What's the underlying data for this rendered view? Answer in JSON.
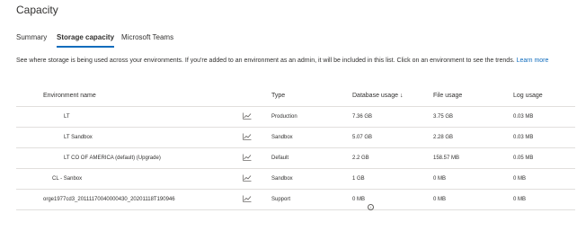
{
  "page": {
    "title": "Capacity"
  },
  "tabs": [
    {
      "label": "Summary"
    },
    {
      "label": "Storage capacity"
    },
    {
      "label": "Microsoft Teams"
    }
  ],
  "description": {
    "text": "See where storage is being used across your environments. If you're added to an environment as an admin, it will be included in this list. Click on an environment to see the trends.",
    "link": "Learn more"
  },
  "table": {
    "headers": {
      "environment": "Environment name",
      "type": "Type",
      "database": "Database usage",
      "file": "File usage",
      "log": "Log usage"
    },
    "rows": [
      {
        "name": "LT",
        "type": "Production",
        "database": "7.36 GB",
        "file": "3.75 GB",
        "log": "0.03 MB"
      },
      {
        "name": "LT Sandbox",
        "type": "Sandbox",
        "database": "5.07 GB",
        "file": "2.28 GB",
        "log": "0.03 MB"
      },
      {
        "name": "LT CO OF AMERICA (default) (Upgrade)",
        "type": "Default",
        "database": "2.2 GB",
        "file": "158.57 MB",
        "log": "0.05 MB"
      },
      {
        "name": "CL - Sanbox",
        "type": "Sandbox",
        "database": "1 GB",
        "file": "0 MB",
        "log": "0 MB"
      },
      {
        "name": "orge1977cd3_20111170040000430_20201118T190946",
        "type": "Support",
        "database": "0 MB",
        "file": "0 MB",
        "log": "0 MB"
      }
    ]
  },
  "icons": {
    "trend": "trend-chart-icon",
    "info": "info-icon",
    "sort": "sort-descending-icon"
  },
  "colors": {
    "accent": "#0f6cbd",
    "divider": "#e1dfdd"
  }
}
